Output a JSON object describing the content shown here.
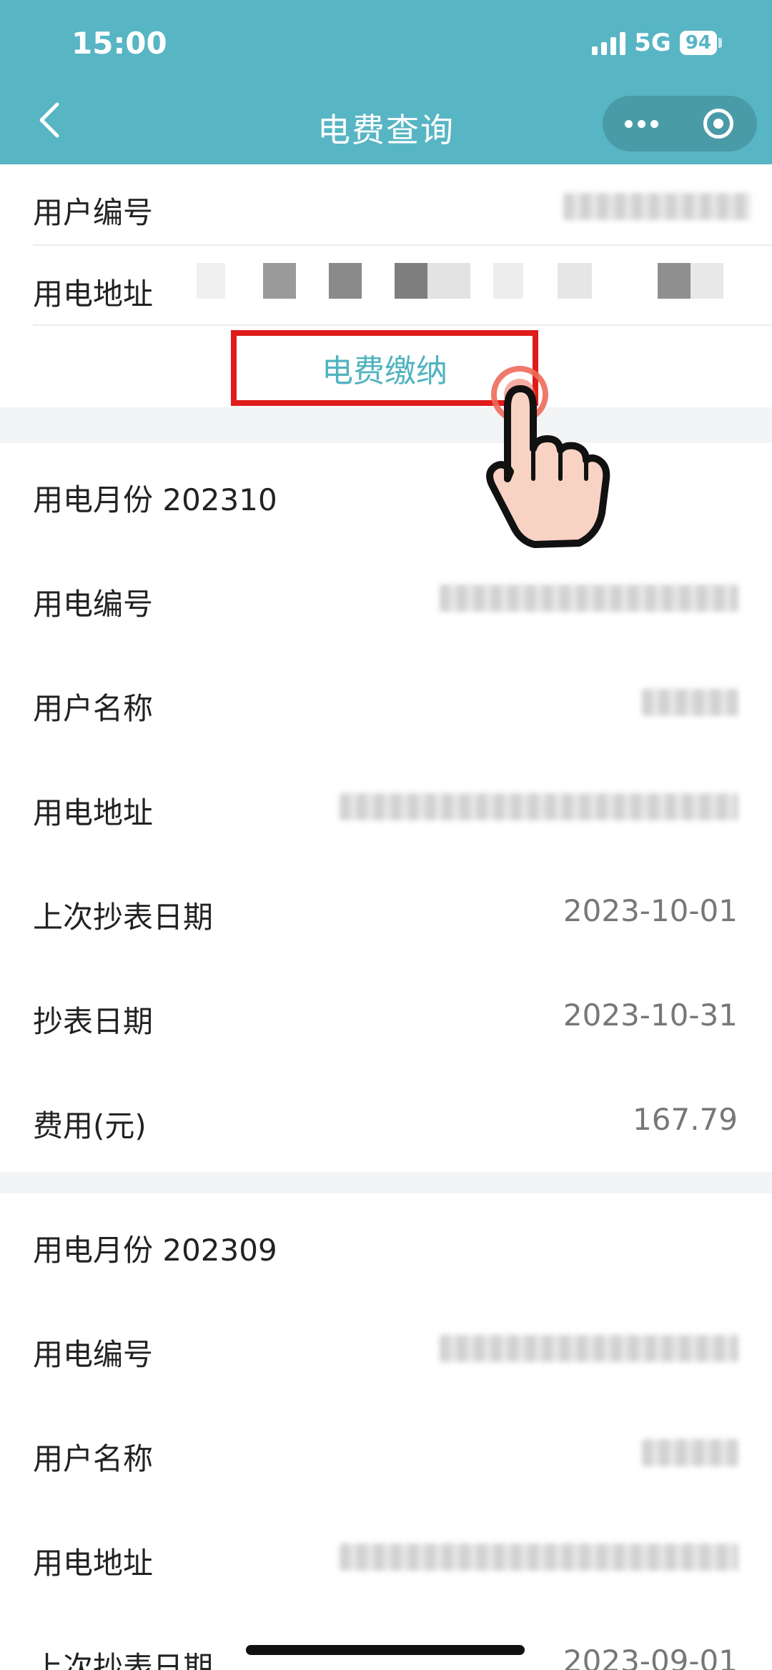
{
  "status_bar": {
    "time": "15:00",
    "network": "5G",
    "battery": "94"
  },
  "nav": {
    "title": "电费查询",
    "back_icon": "chevron-left-icon",
    "more_icon": "more-dots-icon",
    "close_icon": "target-close-icon"
  },
  "account": {
    "user_no_label": "用户编号",
    "address_label": "用电地址",
    "pay_button": "电费缴纳"
  },
  "records": [
    {
      "month_label": "用电月份 202310",
      "meter_no_label": "用电编号",
      "user_name_label": "用户名称",
      "address_label": "用电地址",
      "last_read_label": "上次抄表日期",
      "last_read_value": "2023-10-01",
      "read_label": "抄表日期",
      "read_value": "2023-10-31",
      "fee_label": "费用(元)",
      "fee_value": "167.79"
    },
    {
      "month_label": "用电月份 202309",
      "meter_no_label": "用电编号",
      "user_name_label": "用户名称",
      "address_label": "用电地址",
      "last_read_label": "上次抄表日期",
      "last_read_value": "2023-09-01"
    }
  ],
  "colors": {
    "header": "#57b5c4",
    "pay_text": "#4fb3bf",
    "highlight_border": "#e01b1b"
  }
}
